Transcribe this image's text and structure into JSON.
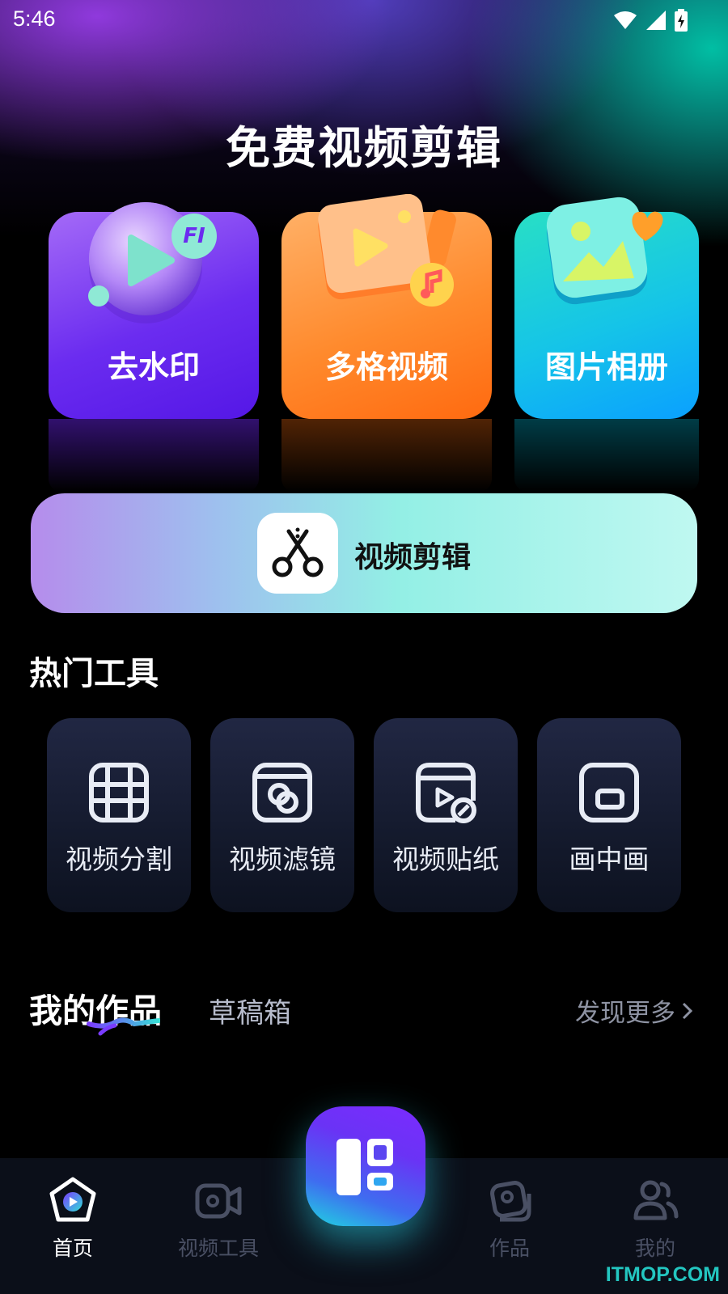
{
  "status_bar": {
    "time": "5:46"
  },
  "hero": {
    "title": "免费视频剪辑"
  },
  "feature_cards": [
    {
      "label": "去水印",
      "badge": "FI"
    },
    {
      "label": "多格视频"
    },
    {
      "label": "图片相册"
    }
  ],
  "edit_banner": {
    "label": "视频剪辑"
  },
  "hot_tools": {
    "title": "热门工具",
    "items": [
      {
        "label": "视频分割",
        "icon": "film-split-icon"
      },
      {
        "label": "视频滤镜",
        "icon": "filter-icon"
      },
      {
        "label": "视频贴纸",
        "icon": "sticker-icon"
      },
      {
        "label": "画中画",
        "icon": "picture-in-picture-icon"
      }
    ]
  },
  "works": {
    "tab_mine": "我的作品",
    "tab_drafts": "草稿箱",
    "discover_more": "发现更多"
  },
  "bottom_nav": {
    "items": [
      {
        "label": "首页",
        "icon": "home-icon",
        "active": true
      },
      {
        "label": "视频工具",
        "icon": "video-camera-icon",
        "active": false
      },
      {
        "label": "作品",
        "icon": "works-icon",
        "active": false
      },
      {
        "label": "我的",
        "icon": "profile-icon",
        "active": false
      }
    ]
  },
  "watermark": "ITMOP.COM",
  "colors": {
    "accent_purple": "#6b2cf0",
    "accent_orange": "#ff8a2d",
    "accent_cyan": "#15c4e8"
  }
}
